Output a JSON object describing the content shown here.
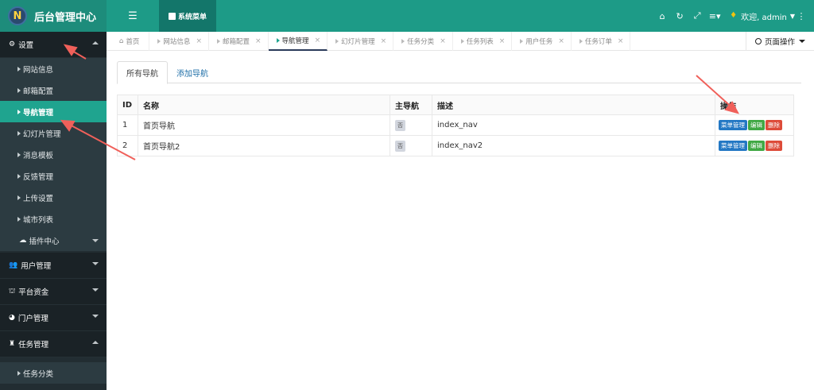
{
  "app": {
    "logo_letter": "N",
    "title": "后台管理中心"
  },
  "header": {
    "menu_button": "系统菜单",
    "icons": [
      "home-icon",
      "refresh-icon",
      "fullscreen-icon",
      "list-icon"
    ],
    "user_greeting": "欢迎, admin"
  },
  "sidebar": {
    "settings_label": "设置",
    "settings_items": [
      "网站信息",
      "邮箱配置",
      "导航管理",
      "幻灯片管理",
      "消息模板",
      "反馈管理",
      "上传设置",
      "城市列表"
    ],
    "plugin_label": "插件中心",
    "user_mgmt": "用户管理",
    "platform_funds": "平台资金",
    "portal_mgmt": "门户管理",
    "task_mgmt": "任务管理",
    "task_items": [
      "任务分类"
    ]
  },
  "tabs": {
    "home": "首页",
    "items": [
      "网站信息",
      "邮箱配置",
      "导航管理",
      "幻灯片管理",
      "任务分类",
      "任务列表",
      "用户任务",
      "任务订单"
    ],
    "close": "×",
    "page_ops": "页面操作"
  },
  "content": {
    "sub_tabs": [
      "所有导航",
      "添加导航"
    ],
    "table": {
      "headers": [
        "ID",
        "名称",
        "主导航",
        "描述",
        "操作"
      ],
      "rows": [
        {
          "id": "1",
          "name": "首页导航",
          "main": "否",
          "desc": "index_nav"
        },
        {
          "id": "2",
          "name": "首页导航2",
          "main": "否",
          "desc": "index_nav2"
        }
      ],
      "buttons": {
        "menu": "菜单管理",
        "edit": "编辑",
        "delete": "删除"
      }
    }
  },
  "colors": {
    "header": "#1d9b87",
    "sidebar": "#222d32",
    "active": "#1fa48f",
    "arrow": "#f0605a"
  }
}
